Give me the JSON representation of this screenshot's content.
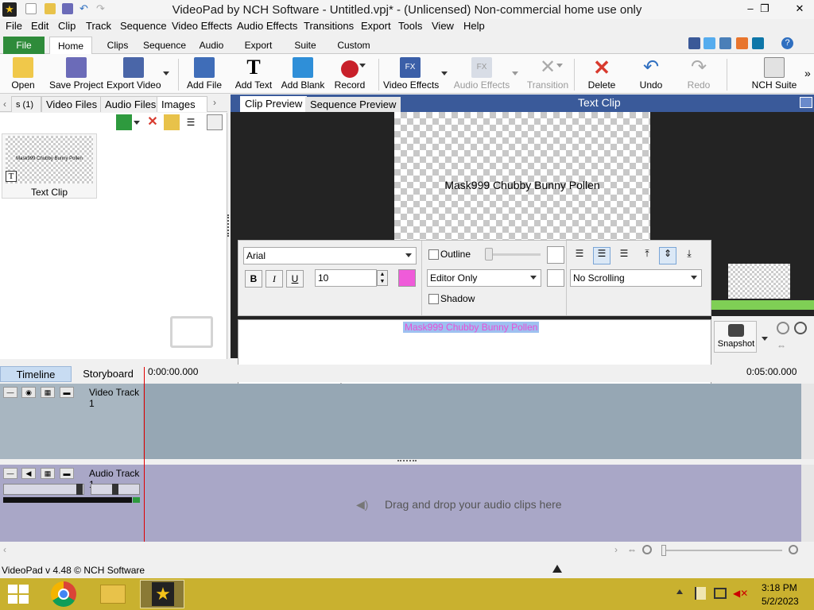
{
  "window": {
    "title": "VideoPad by NCH Software - Untitled.vpj* - (Unlicensed) Non-commercial home use only",
    "minimize": "–",
    "restore": "❐",
    "close": "✕"
  },
  "menu": [
    "File",
    "Edit",
    "Clip",
    "Track",
    "Sequence",
    "Video Effects",
    "Audio Effects",
    "Transitions",
    "Export",
    "Tools",
    "View",
    "Help"
  ],
  "ribbon_tabs": [
    "File",
    "Home",
    "Clips",
    "Sequence",
    "Audio",
    "Export",
    "Suite",
    "Custom"
  ],
  "ribbon": {
    "open": "Open",
    "save": "Save Project",
    "export": "Export Video",
    "add_file": "Add File",
    "add_text": "Add Text",
    "add_blank": "Add Blank",
    "record": "Record",
    "video_effects": "Video Effects",
    "audio_effects": "Audio Effects",
    "transition": "Transition",
    "delete": "Delete",
    "undo": "Undo",
    "redo": "Redo",
    "nch_suite": "NCH Suite",
    "more": "»"
  },
  "left_tabs": {
    "partial": "s (1)",
    "video": "Video Files",
    "audio": "Audio Files",
    "images": "Images (1"
  },
  "bin": {
    "item_label": "Text Clip",
    "thumb_text": "Mask999 Chubby Bunny Pollen"
  },
  "preview": {
    "clip_tab": "Clip Preview",
    "seq_tab": "Sequence Preview",
    "title": "Text Clip",
    "text": "Mask999 Chubby Bunny Pollen"
  },
  "text_panel": {
    "font": "Arial",
    "size": "10",
    "bold": "B",
    "italic": "I",
    "underline": "U",
    "outline": "Outline",
    "shadow": "Shadow",
    "layer": "Editor Only",
    "scroll": "No Scrolling",
    "color": "#ef5bd9"
  },
  "editor": {
    "text": "Mask999 Chubby Bunny Pollen"
  },
  "snapshot": "Snapshot",
  "timeline": {
    "tab_timeline": "Timeline",
    "tab_storyboard": "Storyboard",
    "time_start": "0:00:00.000",
    "time_end": "0:05:00.000",
    "video_track": "Video Track 1",
    "audio_track": "Audio Track 1",
    "audio_hint": "Drag and drop your audio clips here"
  },
  "status": "VideoPad v 4.48 © NCH Software",
  "clock": {
    "time": "3:18 PM",
    "date": "5/2/2023"
  }
}
